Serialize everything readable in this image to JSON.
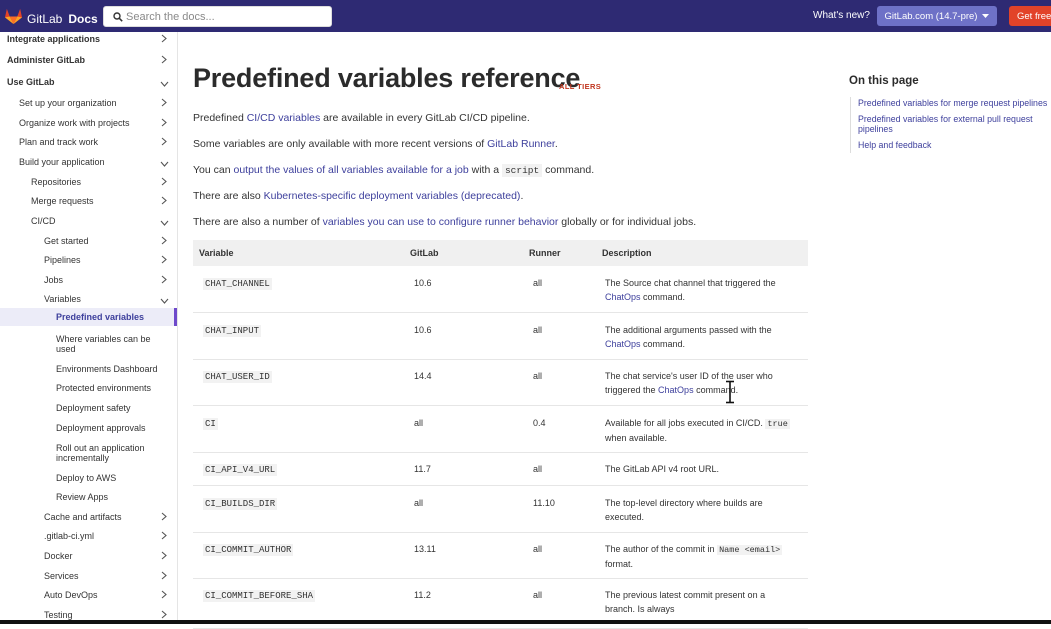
{
  "header": {
    "logo_text": "GitLab",
    "docs_label": "Docs",
    "search_placeholder": "Search the docs...",
    "whats_new": "What's new?",
    "version_label": "GitLab.com (14.7-pre)",
    "get_free_label": "Get free"
  },
  "sidebar": {
    "items": [
      {
        "label": "Integrate applications",
        "chevron": "right"
      },
      {
        "label": "Administer GitLab",
        "chevron": "right"
      },
      {
        "label": "Use GitLab",
        "chevron": "down"
      },
      {
        "label": "Set up your organization",
        "chevron": "right"
      },
      {
        "label": "Organize work with projects",
        "chevron": "right"
      },
      {
        "label": "Plan and track work",
        "chevron": "right"
      },
      {
        "label": "Build your application",
        "chevron": "down"
      },
      {
        "label": "Repositories",
        "chevron": "right"
      },
      {
        "label": "Merge requests",
        "chevron": "right"
      },
      {
        "label": "CI/CD",
        "chevron": "down"
      },
      {
        "label": "Get started",
        "chevron": "right"
      },
      {
        "label": "Pipelines",
        "chevron": "right"
      },
      {
        "label": "Jobs",
        "chevron": "right"
      },
      {
        "label": "Variables",
        "chevron": "down"
      },
      {
        "label": "Predefined variables",
        "chevron": ""
      },
      {
        "label": "Where variables can be",
        "label2": "used",
        "chevron": ""
      },
      {
        "label": "Environments Dashboard",
        "chevron": ""
      },
      {
        "label": "Protected environments",
        "chevron": ""
      },
      {
        "label": "Deployment safety",
        "chevron": ""
      },
      {
        "label": "Deployment approvals",
        "chevron": ""
      },
      {
        "label": "Roll out an application",
        "label2": "incrementally",
        "chevron": ""
      },
      {
        "label": "Deploy to AWS",
        "chevron": ""
      },
      {
        "label": "Review Apps",
        "chevron": ""
      },
      {
        "label": "Cache and artifacts",
        "chevron": "right"
      },
      {
        "label": ".gitlab-ci.yml",
        "chevron": "right"
      },
      {
        "label": "Docker",
        "chevron": "right"
      },
      {
        "label": "Services",
        "chevron": "right"
      },
      {
        "label": "Auto DevOps",
        "chevron": "right"
      },
      {
        "label": "Testing",
        "chevron": "right"
      }
    ]
  },
  "main": {
    "title": "Predefined variables reference",
    "tier_badge": "ALL TIERS",
    "p1": {
      "before": "Predefined ",
      "link": "CI/CD variables",
      "after": " are available in every GitLab CI/CD pipeline."
    },
    "p2": {
      "before": "Some variables are only available with more recent versions of ",
      "link": "GitLab Runner",
      "after": "."
    },
    "p3": {
      "before": "You can ",
      "link": "output the values of all variables available for a job",
      "mid": " with a ",
      "code": "script",
      "after": " command."
    },
    "p4": {
      "before": "There are also ",
      "link": "Kubernetes-specific deployment variables (deprecated)",
      "after": "."
    },
    "p5": {
      "before": "There are also a number of ",
      "link": "variables you can use to configure runner behavior",
      "after": " globally or for individual jobs."
    }
  },
  "table": {
    "headers": [
      "Variable",
      "GitLab",
      "Runner",
      "Description"
    ],
    "rows": [
      {
        "variable": "CHAT_CHANNEL",
        "gitlab": "10.6",
        "runner": "all",
        "desc": {
          "l1": "The Source chat channel that triggered the",
          "link": "ChatOps",
          "l2": " command."
        }
      },
      {
        "variable": "CHAT_INPUT",
        "gitlab": "10.6",
        "runner": "all",
        "desc": {
          "l1": "The additional arguments passed with the",
          "link": "ChatOps",
          "l2": " command."
        }
      },
      {
        "variable": "CHAT_USER_ID",
        "gitlab": "14.4",
        "runner": "all",
        "desc": {
          "l1": "The chat service's user ID of the user who",
          "pre": "triggered the ",
          "link": "ChatOps",
          "l2": " command."
        }
      },
      {
        "variable": "CI",
        "gitlab": "all",
        "runner": "0.4",
        "desc": {
          "l1": "Available for all jobs executed in CI/CD. ",
          "code": "true",
          "l2": "when available."
        }
      },
      {
        "variable": "CI_API_V4_URL",
        "gitlab": "11.7",
        "runner": "all",
        "desc": {
          "l1": "The GitLab API v4 root URL."
        }
      },
      {
        "variable": "CI_BUILDS_DIR",
        "gitlab": "all",
        "runner": "11.10",
        "desc": {
          "l1": "The top-level directory where builds are",
          "l2": "executed."
        }
      },
      {
        "variable": "CI_COMMIT_AUTHOR",
        "gitlab": "13.11",
        "runner": "all",
        "desc": {
          "l1": "The author of the commit in ",
          "code": "Name <email>",
          "l2": "format."
        }
      },
      {
        "variable": "CI_COMMIT_BEFORE_SHA",
        "gitlab": "11.2",
        "runner": "all",
        "desc": {
          "l1": "The previous latest commit present on a",
          "l2": "branch. Is always"
        }
      }
    ]
  },
  "on_this_page": {
    "title": "On this page",
    "links": [
      "Predefined variables for merge request pipelines",
      "Predefined variables for external pull request",
      "pipelines",
      "Help and feedback"
    ]
  },
  "colors": {
    "nav_bg": "#2e2a73",
    "link": "#3d3f9c",
    "tier": "#c0341d",
    "version_btn": "#6e71c7",
    "get_free_btn": "#e24329"
  }
}
